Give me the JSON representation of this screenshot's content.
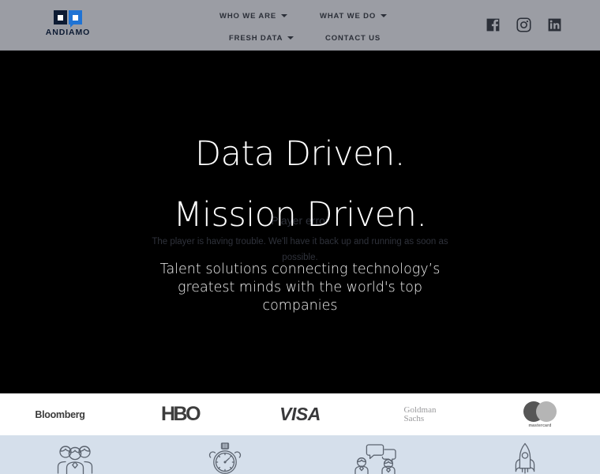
{
  "header": {
    "logo": {
      "brand_name": "ANDIAMO",
      "mark_dark_color": "#0d1b33",
      "mark_blue_color": "#1f73d4"
    },
    "background_color": "#9b9da4",
    "nav": [
      {
        "label": "WHO WE ARE",
        "has_dropdown": true
      },
      {
        "label": "WHAT WE DO",
        "has_dropdown": true
      },
      {
        "label": "FRESH DATA",
        "has_dropdown": true
      },
      {
        "label": "CONTACT US",
        "has_dropdown": false
      }
    ],
    "socials": [
      {
        "name": "facebook-icon",
        "label": "Facebook"
      },
      {
        "name": "instagram-icon",
        "label": "Instagram"
      },
      {
        "name": "linkedin-icon",
        "label": "LinkedIn"
      }
    ]
  },
  "hero": {
    "background_color": "#000000",
    "headline_line1": "Data Driven.",
    "headline_line2": "Mission Driven.",
    "subheadline": "Talent solutions connecting technology’s greatest minds with the world's top companies",
    "player_error": {
      "title": "Player error",
      "message": "The player is having trouble. We'll have it back up and running as soon as possible."
    }
  },
  "logo_band": {
    "background_color": "#ffffff",
    "brands": [
      {
        "name": "bloomberg-logo",
        "label": "Bloomberg"
      },
      {
        "name": "hbo-logo",
        "label": "HBO"
      },
      {
        "name": "visa-logo",
        "label": "VISA"
      },
      {
        "name": "goldman-sachs-logo",
        "label_line1": "Goldman",
        "label_line2": "Sachs"
      },
      {
        "name": "mastercard-logo",
        "label": "mastercard"
      }
    ]
  },
  "features": {
    "background_color": "#d5dfeb",
    "items": [
      {
        "icon": "people-group-icon"
      },
      {
        "icon": "stopwatch-icon"
      },
      {
        "icon": "people-conversation-icon"
      },
      {
        "icon": "rocket-icon"
      }
    ]
  }
}
